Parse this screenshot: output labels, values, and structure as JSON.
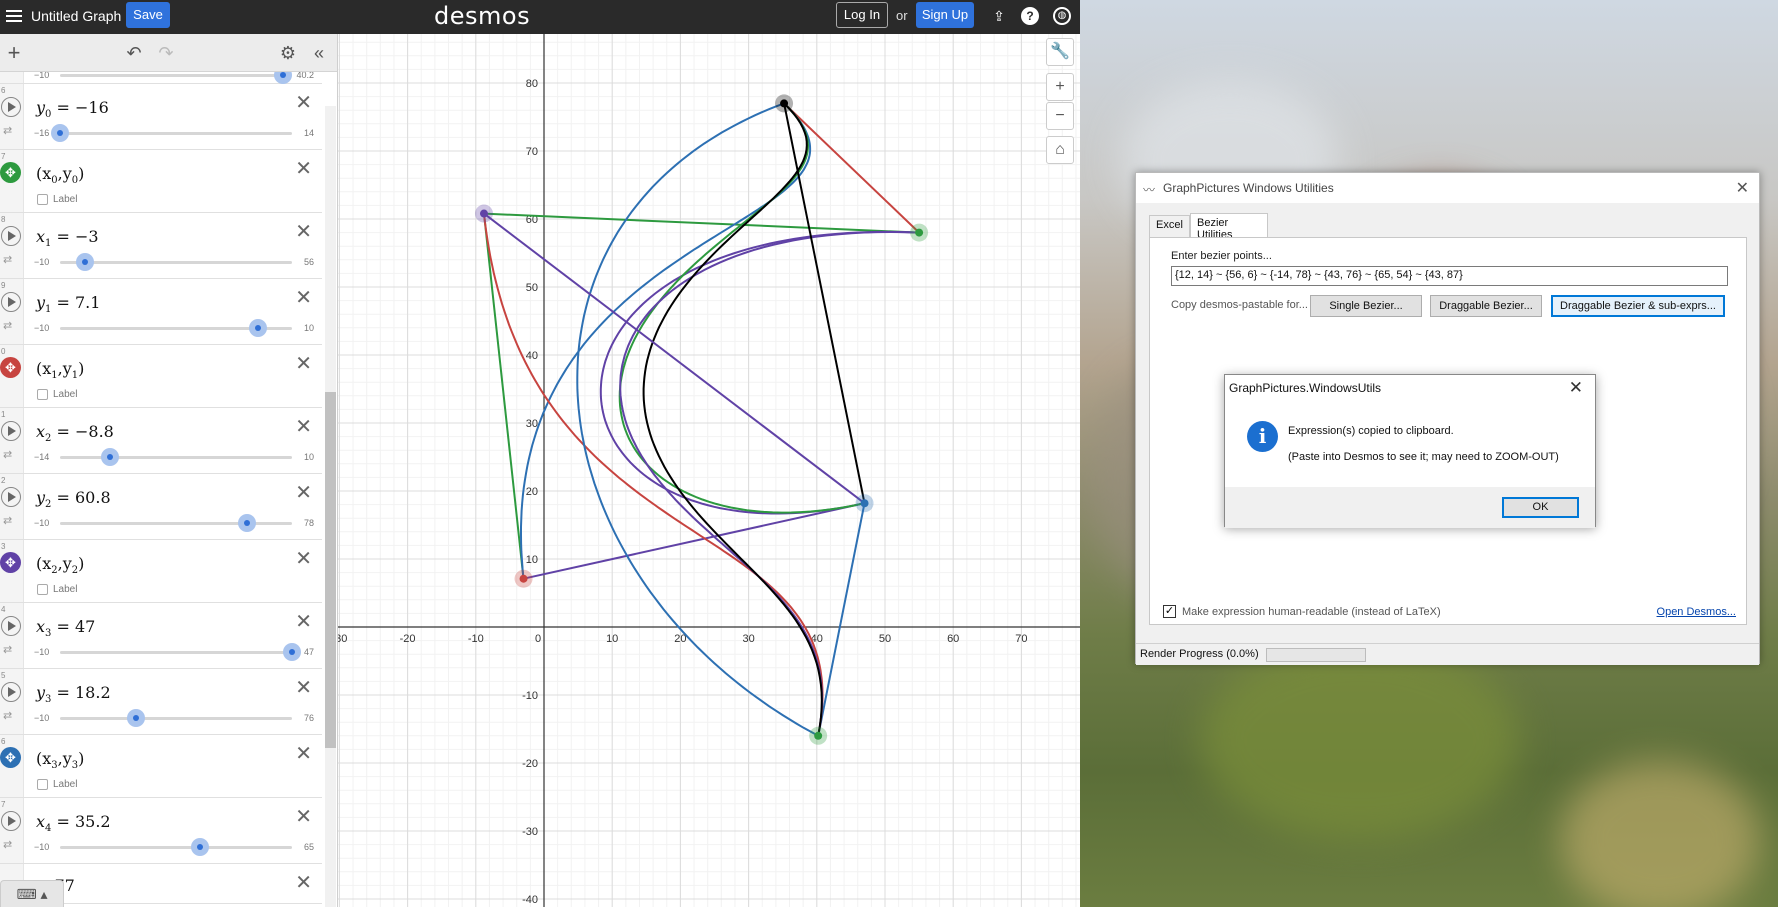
{
  "app": {
    "title": "Untitled Graph",
    "save_label": "Save",
    "logo": "desmos",
    "login_label": "Log In",
    "or_label": "or",
    "signup_label": "Sign Up"
  },
  "expressions": [
    {
      "num": "6",
      "type": "slider",
      "lhs": "y",
      "sub": "0",
      "value": "−16",
      "min": "−16",
      "max": "14",
      "knob": 0.0
    },
    {
      "num": "7",
      "type": "point",
      "text": "(x",
      "sub1": "0",
      "mid": ",y",
      "sub2": "0",
      "end": ")",
      "color": "#2d9a3f",
      "label": "Label"
    },
    {
      "num": "8",
      "type": "slider",
      "lhs": "x",
      "sub": "1",
      "value": "−3",
      "min": "−10",
      "max": "56",
      "knob": 0.106
    },
    {
      "num": "9",
      "type": "slider",
      "lhs": "y",
      "sub": "1",
      "value": "7.1",
      "min": "−10",
      "max": "10",
      "knob": 0.855
    },
    {
      "num": "0",
      "type": "point",
      "text": "(x",
      "sub1": "1",
      "mid": ",y",
      "sub2": "1",
      "end": ")",
      "color": "#c74440",
      "label": "Label"
    },
    {
      "num": "1",
      "type": "slider",
      "lhs": "x",
      "sub": "2",
      "value": "−8.8",
      "min": "−14",
      "max": "10",
      "knob": 0.217
    },
    {
      "num": "2",
      "type": "slider",
      "lhs": "y",
      "sub": "2",
      "value": "60.8",
      "min": "−10",
      "max": "78",
      "knob": 0.805
    },
    {
      "num": "3",
      "type": "point",
      "text": "(x",
      "sub1": "2",
      "mid": ",y",
      "sub2": "2",
      "end": ")",
      "color": "#6042a6",
      "label": "Label"
    },
    {
      "num": "4",
      "type": "slider",
      "lhs": "x",
      "sub": "3",
      "value": "47",
      "min": "−10",
      "max": "47",
      "knob": 1.0
    },
    {
      "num": "5",
      "type": "slider",
      "lhs": "y",
      "sub": "3",
      "value": "18.2",
      "min": "−10",
      "max": "76",
      "knob": 0.328
    },
    {
      "num": "6",
      "type": "point",
      "text": "(x",
      "sub1": "3",
      "mid": ",y",
      "sub2": "3",
      "end": ")",
      "color": "#2d70b3",
      "label": "Label"
    },
    {
      "num": "7",
      "type": "slider",
      "lhs": "x",
      "sub": "4",
      "value": "35.2",
      "min": "−10",
      "max": "65",
      "knob": 0.603
    }
  ],
  "partial_top": {
    "min": "−10",
    "max": "40.2"
  },
  "partial_bottom": {
    "value": "= 77"
  },
  "graph": {
    "x_ticks": [
      "-30",
      "-20",
      "-10",
      "0",
      "10",
      "20",
      "30",
      "40",
      "50",
      "60",
      "70"
    ],
    "y_ticks": [
      "80",
      "70",
      "60",
      "50",
      "40",
      "30",
      "20",
      "10",
      "-10",
      "-20",
      "-30",
      "-40"
    ],
    "points": [
      {
        "name": "p0",
        "x": 35.2,
        "y": 77,
        "color": "#000000"
      },
      {
        "name": "p1",
        "x": -8.8,
        "y": 60.8,
        "color": "#6042a6"
      },
      {
        "name": "p2",
        "x": 55,
        "y": 58,
        "color": "#2d9a3f"
      },
      {
        "name": "p3",
        "x": -3,
        "y": 7.1,
        "color": "#c74440"
      },
      {
        "name": "p4",
        "x": 47,
        "y": 18.2,
        "color": "#2d70b3"
      },
      {
        "name": "p5",
        "x": 40.2,
        "y": -16,
        "color": "#2d9a3f"
      }
    ]
  },
  "utility": {
    "title": "GraphPictures Windows Utilities",
    "tab1": "Excel",
    "tab2": "Bezier Utilities",
    "enter_label": "Enter bezier points...",
    "points_value": "{12, 14} ~ {56, 6} ~ {-14, 78} ~ {43, 76} ~ {65, 54} ~ {43, 87}",
    "copy_label": "Copy desmos-pastable for...",
    "btn_single": "Single Bezier...",
    "btn_draggable": "Draggable Bezier...",
    "btn_draggable_sub": "Draggable Bezier & sub-exprs...",
    "human_readable": "Make expression human-readable (instead of LaTeX)",
    "open_desmos": "Open Desmos...",
    "render_progress": "Render Progress (0.0%)"
  },
  "dialog": {
    "title": "GraphPictures.WindowsUtils",
    "line1": "Expression(s) copied to clipboard.",
    "line2": "(Paste into Desmos to see it; may need to ZOOM-OUT)",
    "ok": "OK"
  }
}
